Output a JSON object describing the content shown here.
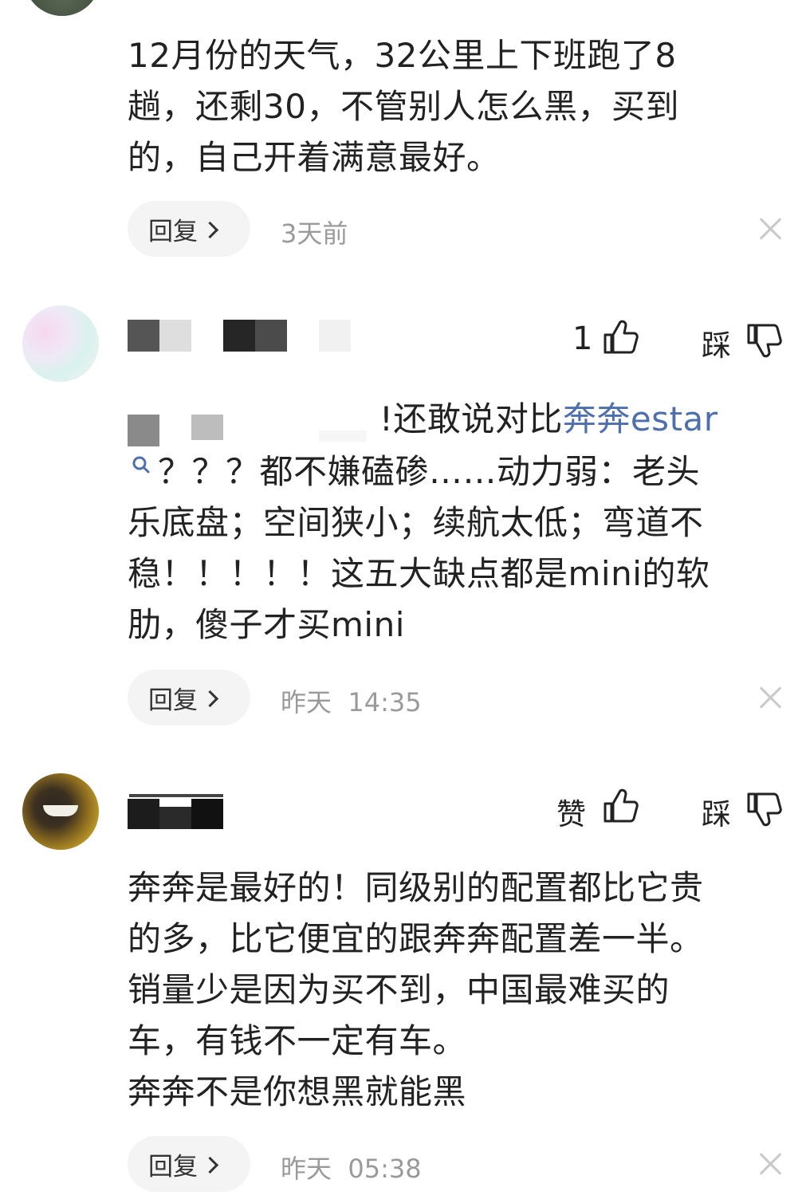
{
  "comments": [
    {
      "text": "12月份的天气，32公里上下班跑了8\n趟，还剩30，不管别人怎么黑，买到\n的，自己开着满意最好。",
      "reply_label": "回复",
      "time": "3天前"
    },
    {
      "like_count": "1",
      "dislike_label": "踩",
      "text_line1_visible": "!还敢说对比",
      "link_text": "奔奔estar",
      "text_rest": "？？？都不嫌磕碜……动力弱：老头\n乐底盘；空间狭小；续航太低；弯道不\n稳！！！！！这五大缺点都是mini的软\n肋，傻子才买mini",
      "reply_label": "回复",
      "time": "昨天  14:35"
    },
    {
      "like_label": "赞",
      "dislike_label": "踩",
      "text": "奔奔是最好的！同级别的配置都比它贵\n的多，比它便宜的跟奔奔配置差一半。\n销量少是因为买不到，中国最难买的\n车，有钱不一定有车。\n奔奔不是你想黑就能黑",
      "reply_label": "回复",
      "time": "昨天  05:38"
    }
  ],
  "icons": {
    "like": "thumbs-up-icon",
    "dislike": "thumbs-down-icon",
    "close": "close-icon",
    "search": "search-icon"
  },
  "colors": {
    "link": "#4d6fae",
    "meta": "#9a9a9a",
    "reply_bg": "#f4f4f4"
  }
}
